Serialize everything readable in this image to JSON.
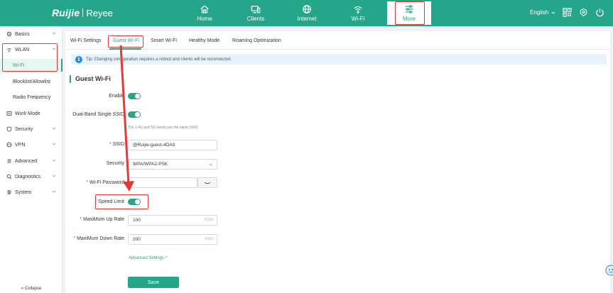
{
  "header": {
    "brand": "Ruijie",
    "sub_brand": "Reyee",
    "language": "English",
    "nav": [
      {
        "label": "Home",
        "icon": "home-icon"
      },
      {
        "label": "Clients",
        "icon": "clients-icon"
      },
      {
        "label": "Internet",
        "icon": "globe-icon"
      },
      {
        "label": "Wi-Fi",
        "icon": "wifi-icon"
      },
      {
        "label": "More",
        "icon": "more-icon"
      }
    ],
    "accent_color": "#25a58a",
    "highlight_color": "#e53935"
  },
  "sidebar": {
    "items": [
      {
        "label": "Basics"
      },
      {
        "label": "WLAN"
      },
      {
        "label": "Work Mode"
      },
      {
        "label": "Security"
      },
      {
        "label": "VPN"
      },
      {
        "label": "Advanced"
      },
      {
        "label": "Diagnostics"
      },
      {
        "label": "System"
      }
    ],
    "wlan_sub": [
      {
        "label": "Wi-Fi"
      },
      {
        "label": "Blocklist/Allowlist"
      },
      {
        "label": "Radio Frequency"
      }
    ],
    "collapse_label": "Collapse"
  },
  "tabs": [
    {
      "label": "Wi-Fi Settings"
    },
    {
      "label": "Guest Wi-Fi"
    },
    {
      "label": "Smart Wi-Fi"
    },
    {
      "label": "Healthy Mode"
    },
    {
      "label": "Roaming Optimization"
    }
  ],
  "tip": {
    "text": "Tip: Changing configuration requires a reboot and clients will be reconnected."
  },
  "section_title": "Guest Wi-Fi",
  "form": {
    "enable_label": "Enable",
    "dual_band_label": "Dual-Band Single SSID",
    "dual_band_hint": "The 2.4G and 5G bands use the same SSID.",
    "ssid_label": "SSID",
    "ssid_value": "@Ruijie-guest-4DA0",
    "security_label": "Security",
    "security_value": "WPA/WPA2-PSK",
    "password_label": "Wi-Fi Password",
    "speed_limit_label": "Speed Limit",
    "up_rate_label": "MaxiMum Up Rate",
    "up_rate_value": "100",
    "up_rate_unit": "Kbps",
    "down_rate_label": "MaxiMum Down Rate",
    "down_rate_value": "200",
    "down_rate_unit": "kbps",
    "advanced_settings": "Advanced Settings",
    "save_label": "Save"
  }
}
